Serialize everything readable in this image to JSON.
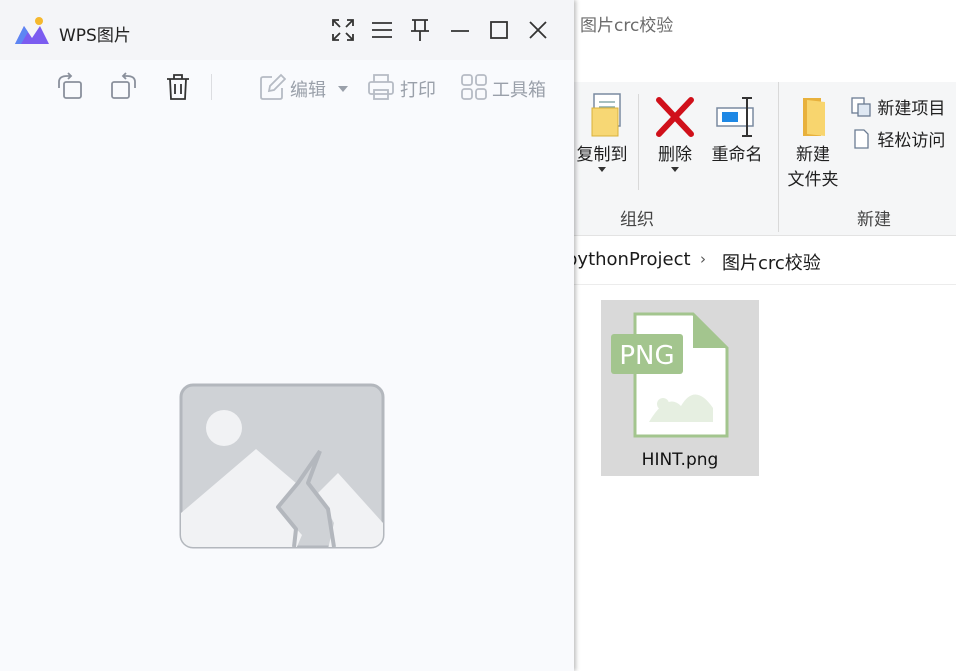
{
  "explorer": {
    "window_title": "图片crc校验",
    "ribbon": {
      "copy_to": "复制到",
      "delete": "删除",
      "rename": "重命名",
      "new_folder_line1": "新建",
      "new_folder_line2": "文件夹",
      "new_item": "新建项目",
      "easy_access": "轻松访问",
      "group_organize": "组织",
      "group_new": "新建"
    },
    "breadcrumb": [
      "pythonProject",
      "图片crc校验"
    ],
    "files": [
      {
        "name": "HINT.png",
        "type_badge": "PNG"
      }
    ]
  },
  "wps": {
    "title": "WPS图片",
    "toolbar": {
      "edit": "编辑",
      "print": "打印",
      "toolbox": "工具箱"
    },
    "colors": {
      "accent_purple": "#7b5cf0",
      "logo_dot": "#f5b82e",
      "png_green": "#a3c58e"
    }
  }
}
